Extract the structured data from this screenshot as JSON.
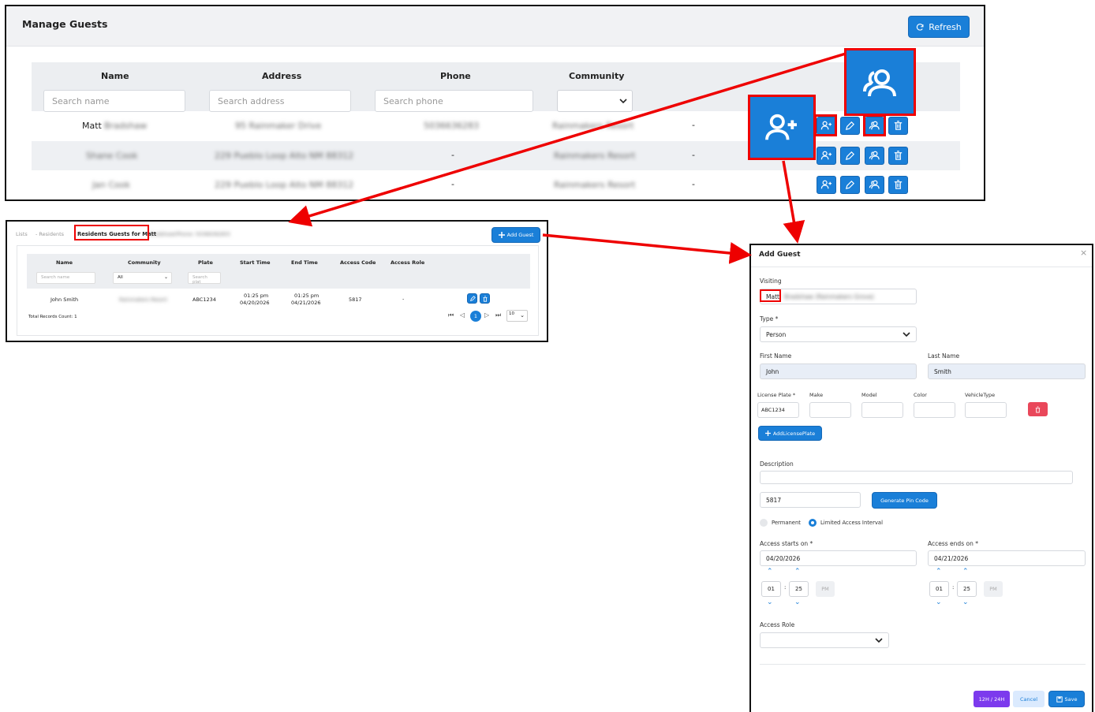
{
  "manage_guests": {
    "title": "Manage Guests",
    "refresh_label": "Refresh",
    "columns": [
      "Name",
      "Address",
      "Phone",
      "Community"
    ],
    "search_name_placeholder": "Search name",
    "search_address_placeholder": "Search address",
    "search_phone_placeholder": "Search phone",
    "rows": [
      {
        "name": "Matt",
        "name_hidden": "Bradshaw",
        "address": "95 Rainmaker Drive",
        "phone": "5036636283",
        "community": "Rainmakers Resort",
        "role": "-"
      },
      {
        "name": "Shane Cook",
        "address": "229 Pueblo Loop Alto NM 88312",
        "phone": "-",
        "community": "Rainmakers Resort",
        "role": "-"
      },
      {
        "name": "Jan Cook",
        "address": "229 Pueblo Loop Alto NM 88312",
        "phone": "-",
        "community": "Rainmakers Resort",
        "role": "-"
      }
    ]
  },
  "residents_guests": {
    "breadcrumb_lists": "Lists",
    "breadcrumb_residents": "- Residents",
    "title": "Residents Guests for Matt",
    "title_hidden": "Bradshaw(Phone: 5036636283)",
    "add_guest_label": "Add Guest",
    "columns": [
      "Name",
      "Community",
      "Plate",
      "Start Time",
      "End Time",
      "Access Code",
      "Access Role"
    ],
    "search_name_placeholder": "Search name",
    "community_select": "All",
    "search_plate_placeholder": "Search plat",
    "row": {
      "name": "John Smith",
      "community": "Rainmakers Resort",
      "plate": "ABC1234",
      "start_time": "01:25 pm",
      "start_date": "04/20/2026",
      "end_time": "01:25 pm",
      "end_date": "04/21/2026",
      "access_code": "5817",
      "access_role": "-"
    },
    "total_records": "Total Records Count: 1",
    "current_page": "1",
    "page_size": "10"
  },
  "add_guest": {
    "title": "Add Guest",
    "close_glyph": "×",
    "visiting_label": "Visiting",
    "visiting_value": "Matt",
    "visiting_hidden": "Bradshaw (Rainmakers Grove)",
    "type_label": "Type *",
    "type_value": "Person",
    "first_name_label": "First Name",
    "first_name_value": "John",
    "last_name_label": "Last Name",
    "last_name_value": "Smith",
    "plate_label": "License Plate *",
    "make_label": "Make",
    "model_label": "Model",
    "color_label": "Color",
    "vehicle_type_label": "VehicleType",
    "plate_value": "ABC1234",
    "add_plate_label": "AddLicensePlate",
    "description_label": "Description",
    "pin_value": "5817",
    "generate_pin_label": "Generate Pin Code",
    "permanent_label": "Permanent",
    "limited_label": "Limited Access Interval",
    "starts_label": "Access starts on *",
    "ends_label": "Access ends on *",
    "start_date": "04/20/2026",
    "end_date": "04/21/2026",
    "start_hour": "01",
    "start_min": "25",
    "end_hour": "01",
    "end_min": "25",
    "ampm": "PM",
    "time_sep": ":",
    "access_role_label": "Access Role",
    "toggle_label": "12H / 24H",
    "cancel_label": "Cancel",
    "save_label": "Save"
  },
  "colors": {
    "accent": "#1a7fd8",
    "highlight": "#e00000",
    "danger": "#e9475a",
    "toggle": "#7c3aed"
  }
}
